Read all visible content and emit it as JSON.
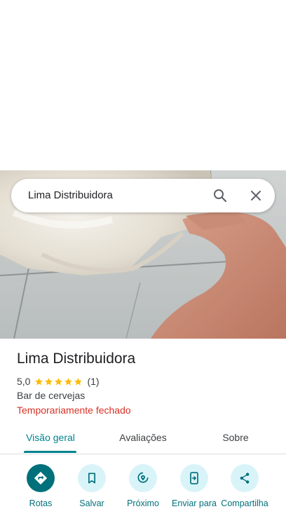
{
  "search": {
    "query": "Lima Distribuidora"
  },
  "place": {
    "name": "Lima Distribuidora",
    "rating": "5,0",
    "stars": 5,
    "review_count": "(1)",
    "category": "Bar de cervejas",
    "status": "Temporariamente fechado"
  },
  "tabs": [
    {
      "label": "Visão geral",
      "active": true
    },
    {
      "label": "Avaliações",
      "active": false
    },
    {
      "label": "Sobre",
      "active": false
    }
  ],
  "actions": [
    {
      "label": "Rotas",
      "icon": "directions-icon"
    },
    {
      "label": "Salvar",
      "icon": "bookmark-icon"
    },
    {
      "label": "Próximo",
      "icon": "nearby-icon"
    },
    {
      "label": "Enviar para",
      "icon": "send-to-device-icon"
    },
    {
      "label": "Compartilha",
      "icon": "share-icon"
    }
  ],
  "colors": {
    "accent": "#00838f",
    "action_fill": "#00707a",
    "action_bg": "#d9f4f8",
    "closed_status": "#d93025",
    "star": "#fbbc04"
  }
}
